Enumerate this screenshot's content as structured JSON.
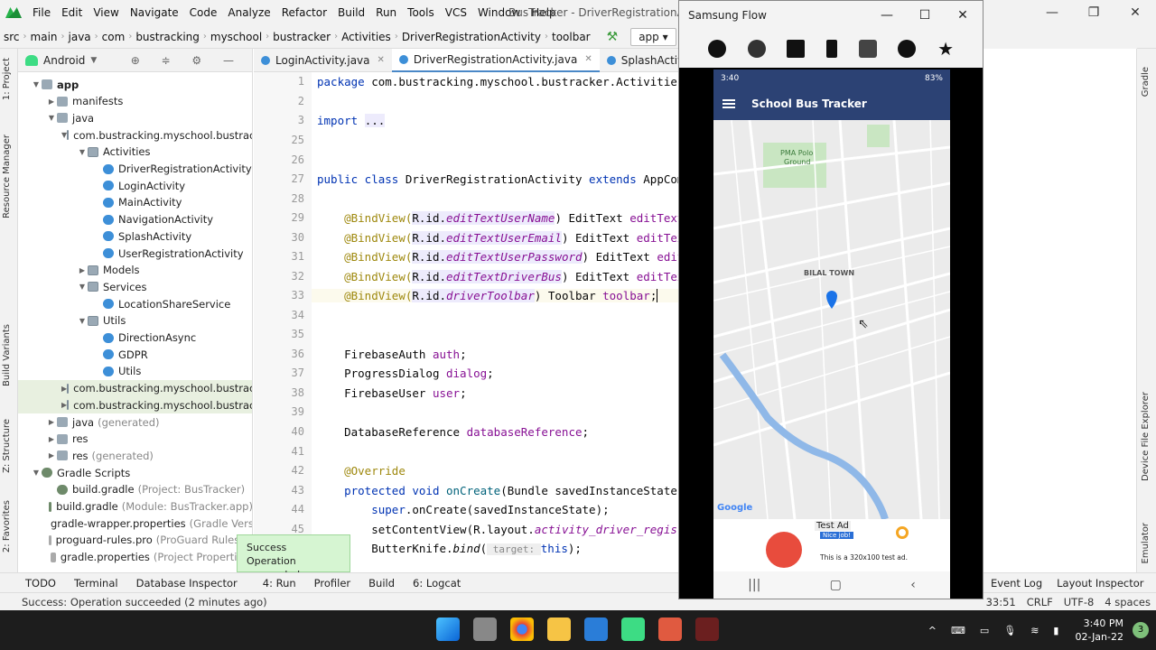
{
  "menubar": {
    "items": [
      "File",
      "Edit",
      "View",
      "Navigate",
      "Code",
      "Analyze",
      "Refactor",
      "Build",
      "Run",
      "Tools",
      "VCS",
      "Window",
      "Help"
    ],
    "title": "BusTracker - DriverRegistrationActi"
  },
  "navbar": {
    "crumbs": [
      "src",
      "main",
      "java",
      "com",
      "bustracking",
      "myschool",
      "bustracker",
      "Activities",
      "DriverRegistrationActivity",
      "toolbar"
    ],
    "run_config": "app"
  },
  "left_strip": {
    "project": "1: Project",
    "resource": "Resource Manager",
    "build_variants": "Build Variants",
    "structure": "Z: Structure",
    "favorites": "2: Favorites"
  },
  "project_panel": {
    "view": "Android",
    "tree": [
      {
        "label": "app",
        "icon": "folder",
        "depth": 0,
        "arrow": "▼",
        "bold": true
      },
      {
        "label": "manifests",
        "icon": "folder",
        "depth": 1,
        "arrow": "▶"
      },
      {
        "label": "java",
        "icon": "folder",
        "depth": 1,
        "arrow": "▼"
      },
      {
        "label": "com.bustracking.myschool.bustracker",
        "icon": "pkg",
        "depth": 2,
        "arrow": "▼"
      },
      {
        "label": "Activities",
        "icon": "pkg",
        "depth": 3,
        "arrow": "▼"
      },
      {
        "label": "DriverRegistrationActivity",
        "icon": "cls",
        "depth": 4,
        "arrow": ""
      },
      {
        "label": "LoginActivity",
        "icon": "cls",
        "depth": 4,
        "arrow": ""
      },
      {
        "label": "MainActivity",
        "icon": "cls",
        "depth": 4,
        "arrow": ""
      },
      {
        "label": "NavigationActivity",
        "icon": "cls",
        "depth": 4,
        "arrow": ""
      },
      {
        "label": "SplashActivity",
        "icon": "cls",
        "depth": 4,
        "arrow": ""
      },
      {
        "label": "UserRegistrationActivity",
        "icon": "cls",
        "depth": 4,
        "arrow": ""
      },
      {
        "label": "Models",
        "icon": "pkg",
        "depth": 3,
        "arrow": "▶"
      },
      {
        "label": "Services",
        "icon": "pkg",
        "depth": 3,
        "arrow": "▼"
      },
      {
        "label": "LocationShareService",
        "icon": "cls",
        "depth": 4,
        "arrow": ""
      },
      {
        "label": "Utils",
        "icon": "pkg",
        "depth": 3,
        "arrow": "▼"
      },
      {
        "label": "DirectionAsync",
        "icon": "cls",
        "depth": 4,
        "arrow": ""
      },
      {
        "label": "GDPR",
        "icon": "cls",
        "depth": 4,
        "arrow": ""
      },
      {
        "label": "Utils",
        "icon": "cls",
        "depth": 4,
        "arrow": ""
      },
      {
        "label": "com.bustracking.myschool.bustracker",
        "icon": "pkg",
        "depth": 2,
        "arrow": "▶",
        "sel": true
      },
      {
        "label": "com.bustracking.myschool.bustracker",
        "icon": "pkg",
        "depth": 2,
        "arrow": "▶",
        "sel": true
      },
      {
        "label": "java",
        "icon": "folder",
        "depth": 1,
        "arrow": "▶",
        "dim": "(generated)"
      },
      {
        "label": "res",
        "icon": "folder",
        "depth": 1,
        "arrow": "▶"
      },
      {
        "label": "res",
        "icon": "folder",
        "depth": 1,
        "arrow": "▶",
        "dim": "(generated)"
      },
      {
        "label": "Gradle Scripts",
        "icon": "grad",
        "depth": 0,
        "arrow": "▼"
      },
      {
        "label": "build.gradle",
        "icon": "grad",
        "depth": 1,
        "arrow": "",
        "dim": "(Project: BusTracker)"
      },
      {
        "label": "build.gradle",
        "icon": "grad",
        "depth": 1,
        "arrow": "",
        "dim": "(Module: BusTracker.app)"
      },
      {
        "label": "gradle-wrapper.properties",
        "icon": "file",
        "depth": 1,
        "arrow": "",
        "dim": "(Gradle Version"
      },
      {
        "label": "proguard-rules.pro",
        "icon": "file",
        "depth": 1,
        "arrow": "",
        "dim": "(ProGuard Rules fo"
      },
      {
        "label": "gradle.properties",
        "icon": "file",
        "depth": 1,
        "arrow": "",
        "dim": "(Project Properties)"
      }
    ]
  },
  "editor": {
    "tabs": [
      {
        "label": "LoginActivity.java",
        "active": false
      },
      {
        "label": "DriverRegistrationActivity.java",
        "active": true
      },
      {
        "label": "SplashActivity.java",
        "active": false
      }
    ],
    "line_numbers": [
      "1",
      "2",
      "3",
      "25",
      "26",
      "27",
      "28",
      "29",
      "30",
      "31",
      "32",
      "33",
      "34",
      "35",
      "36",
      "37",
      "38",
      "39",
      "40",
      "41",
      "42",
      "43",
      "44",
      "45"
    ],
    "lines": {
      "l1a": "package ",
      "l1b": "com.bustracking.myschool.bustracker.Activitie",
      "l3a": "import ",
      "l3b": "...",
      "l27a": "public class ",
      "l27b": "DriverRegistrationActivity ",
      "l27c": "extends ",
      "l27d": "AppCom",
      "bind": "@BindView(",
      "rid": "R.id.",
      "l29f": "editTextUserName",
      "l29t": ") EditText ",
      "l29v": "editText",
      "l30f": "editTextUserEmail",
      "l30t": ") EditText ",
      "l30v": "editTex",
      "l31f": "editTextUserPassword",
      "l31t": ") EditText ",
      "l31v": "edit",
      "l32f": "editTextDriverBus",
      "l32t": ") EditText ",
      "l32v": "editTex",
      "l33f": "driverToolbar",
      "l33t": ") Toolbar ",
      "l33v": "toolbar",
      "l33e": ";",
      "l36a": "FirebaseAuth ",
      "l36b": "auth",
      "l37a": "ProgressDialog ",
      "l37b": "dialog",
      "l38a": "FirebaseUser ",
      "l38b": "user",
      "l40a": "DatabaseReference ",
      "l40b": "databaseReference",
      "semi": ";",
      "l42": "@Override",
      "l43a": "protected void ",
      "l43b": "onCreate",
      "l43c": "(Bundle savedInstanceState",
      "l44a": "super",
      "l44b": ".onCreate(savedInstanceState);",
      "l45a": "setContentView(R.layout.",
      "l45b": "activity_driver_regis",
      "l46a": "ButterKnife.",
      "l46b": "bind",
      "l46c": "(",
      "l46h": " target: ",
      "l46d": "this",
      "l46e": ");"
    }
  },
  "toast": {
    "title": "Success",
    "message": "Operation succeeded"
  },
  "bottom_tools": [
    "TODO",
    "Terminal",
    "Database Inspector",
    "4: Run",
    "Profiler",
    "Build",
    "6: Logcat"
  ],
  "bottom_tools_right": [
    "Event Log",
    "Layout Inspector"
  ],
  "status": {
    "message": "Success: Operation succeeded (2 minutes ago)",
    "position": "33:51",
    "line_sep": "CRLF",
    "encoding": "UTF-8",
    "indent": "4 spaces"
  },
  "right_strip": {
    "gradle": "Gradle",
    "device_explorer": "Device File Explorer",
    "emulator": "Emulator"
  },
  "flow": {
    "title": "Samsung Flow",
    "phone": {
      "time": "3:40",
      "battery": "83%",
      "app_title": "School Bus Tracker",
      "map_labels": [
        "PMA Polo",
        "Ground",
        "BILAL TOWN",
        "Google"
      ],
      "ad_badge": "Test Ad",
      "ad_nice": "Nice job!",
      "ad_text": "This is a 320x100 test ad."
    }
  },
  "taskbar": {
    "time": "3:40 PM",
    "date": "02-Jan-22",
    "notifications": "3"
  },
  "colors": {
    "appbar": "#2c4274",
    "accent": "#4a88c7",
    "success_bg": "#d6f5d2"
  }
}
